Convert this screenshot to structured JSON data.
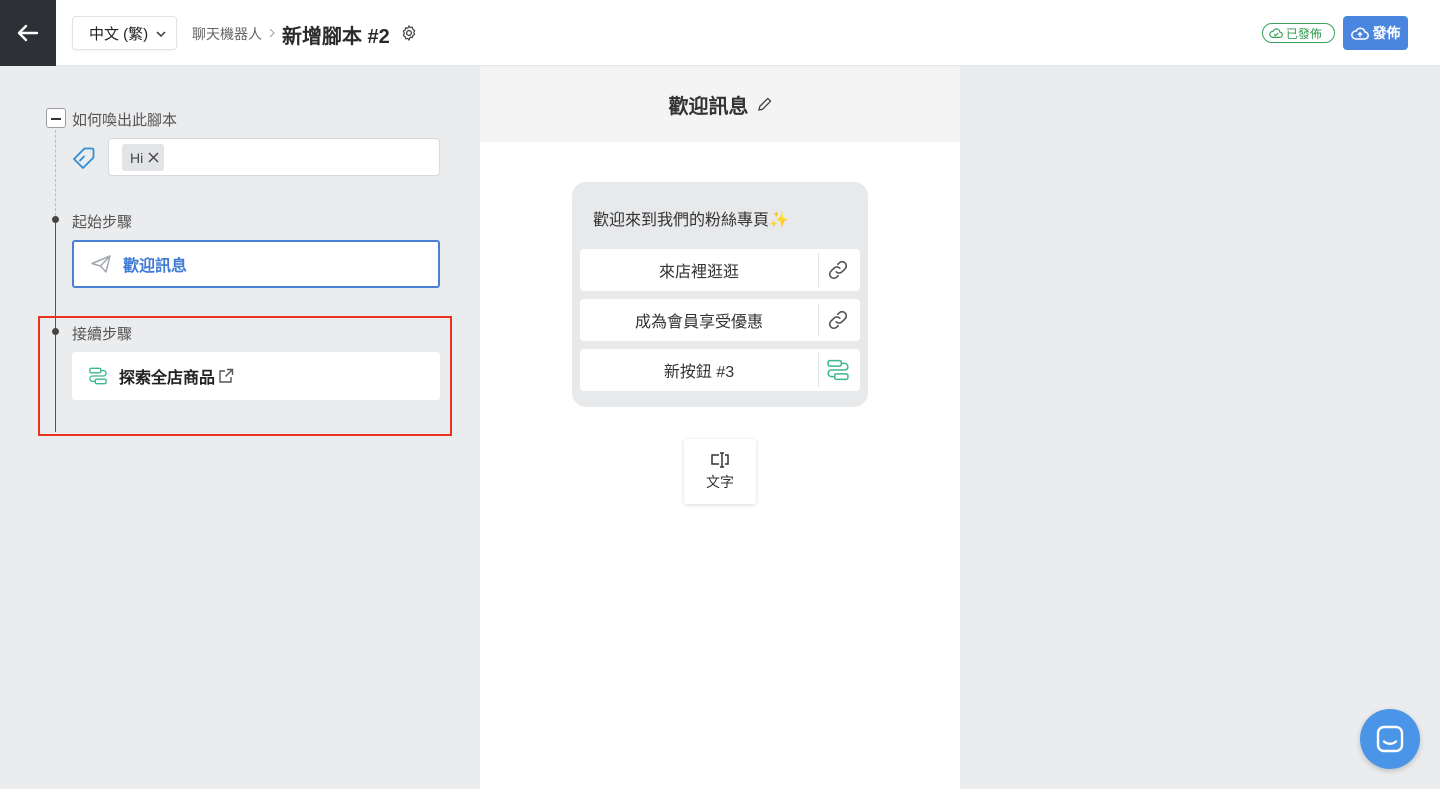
{
  "header": {
    "language": "中文 (繁)",
    "breadcrumb": "聊天機器人",
    "title": "新增腳本 #2",
    "status_badge": "已發佈",
    "publish_label": "發佈"
  },
  "left": {
    "trigger_label": "如何喚出此腳本",
    "keywords": [
      "Hi"
    ],
    "start_label": "起始步驟",
    "start_step": "歡迎訊息",
    "next_label": "接續步驟",
    "next_step": "探索全店商品"
  },
  "middle": {
    "header_title": "歡迎訊息",
    "message": "歡迎來到我們的粉絲專頁",
    "message_emoji": "✨",
    "buttons": [
      {
        "label": "來店裡逛逛",
        "icon": "link-icon"
      },
      {
        "label": "成為會員享受優惠",
        "icon": "link-icon"
      },
      {
        "label": "新按鈕 #3",
        "icon": "flow-icon"
      }
    ],
    "add_text_label": "文字"
  },
  "colors": {
    "accent": "#4a86e0",
    "published": "#3aa45b",
    "highlight": "#e8331f",
    "flow_icon": "#3db88b"
  }
}
